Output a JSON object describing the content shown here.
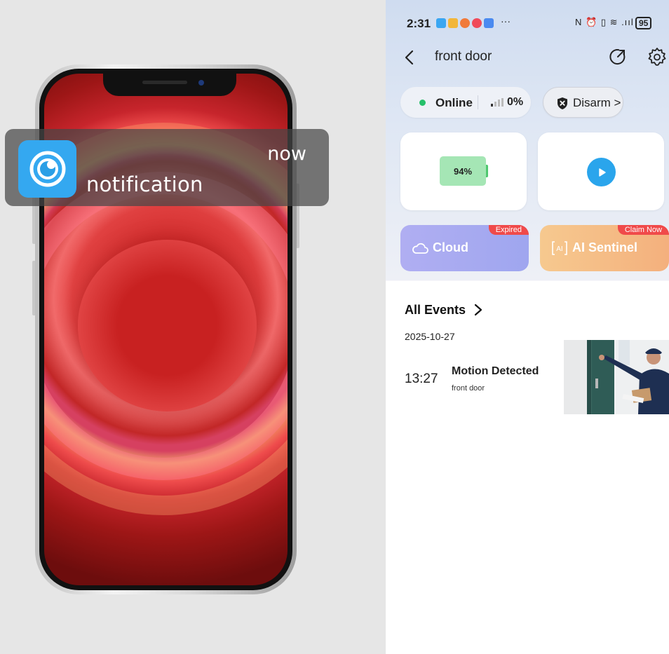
{
  "notification": {
    "title": "notification",
    "time": "now",
    "app_icon": "eye-camera-icon"
  },
  "app": {
    "status_bar": {
      "time": "2:31",
      "more": "···",
      "system_icons": "N ⏰ ▯ ≋ .ııl",
      "battery": "95"
    },
    "header": {
      "title": "front door"
    },
    "status": {
      "online_label": "Online",
      "signal_percent": "0%",
      "online_color": "#25c06a"
    },
    "arm_button": {
      "label": "Disarm >"
    },
    "battery_card": {
      "value": "94%",
      "level": 0.94
    },
    "live_card": {
      "icon": "play-icon"
    },
    "promos": [
      {
        "label": "Cloud",
        "tag": "Expired",
        "icon": "cloud-icon"
      },
      {
        "label": "AI Sentinel",
        "tag": "Claim Now",
        "icon": "ai-icon"
      }
    ],
    "events": {
      "heading": "All Events",
      "date": "2025-10-27",
      "items": [
        {
          "time": "13:27",
          "title": "Motion Detected",
          "device": "front door"
        }
      ]
    }
  }
}
